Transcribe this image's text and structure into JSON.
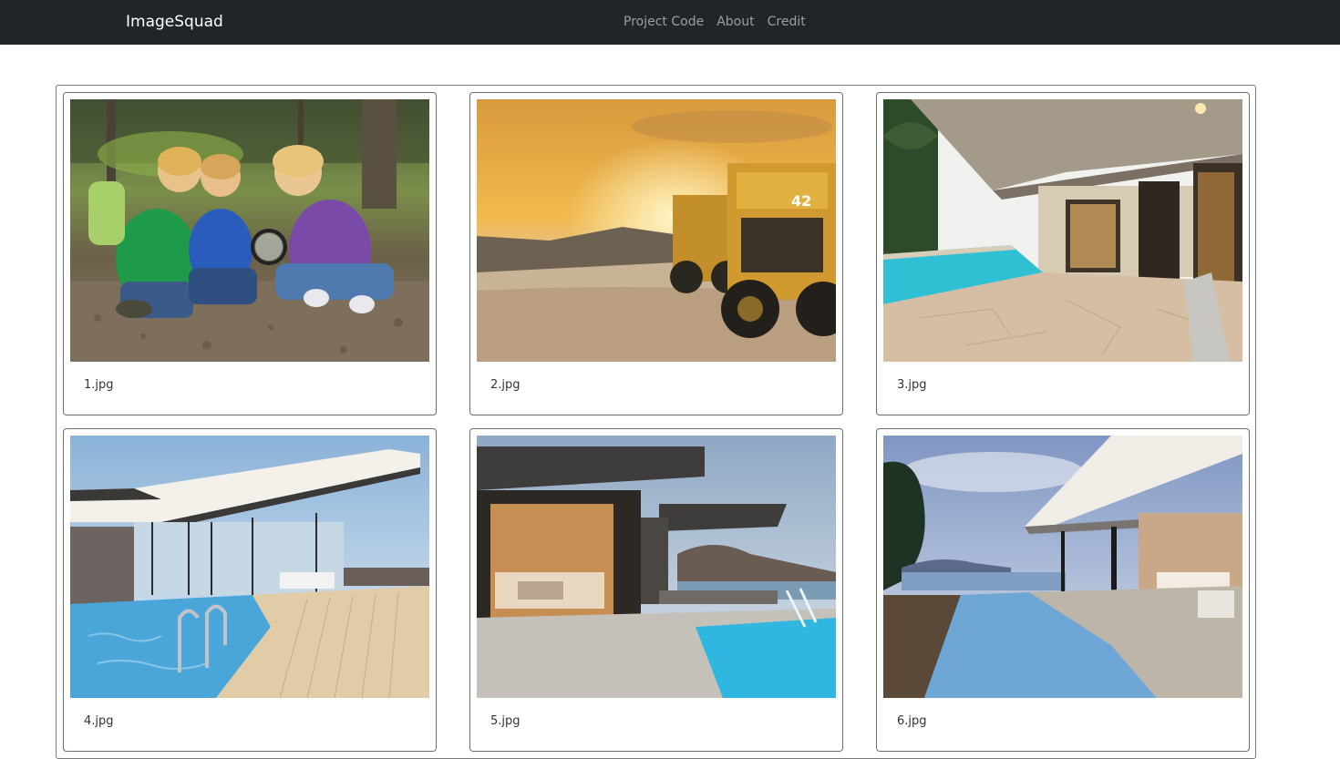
{
  "navbar": {
    "brand": "ImageSquad",
    "links": [
      "Project Code",
      "About",
      "Credit"
    ],
    "background": "#212529"
  },
  "gallery": {
    "items": [
      {
        "caption": "1.jpg",
        "image": "kids-magnifying-glass-forest"
      },
      {
        "caption": "2.jpg",
        "image": "mining-dump-trucks-sunset"
      },
      {
        "caption": "3.jpg",
        "image": "modern-house-pool-patio"
      },
      {
        "caption": "4.jpg",
        "image": "modern-glass-villa-pool"
      },
      {
        "caption": "5.jpg",
        "image": "modern-house-pool-ocean-view"
      },
      {
        "caption": "6.jpg",
        "image": "infinity-pool-terrace-sea-view"
      }
    ]
  }
}
